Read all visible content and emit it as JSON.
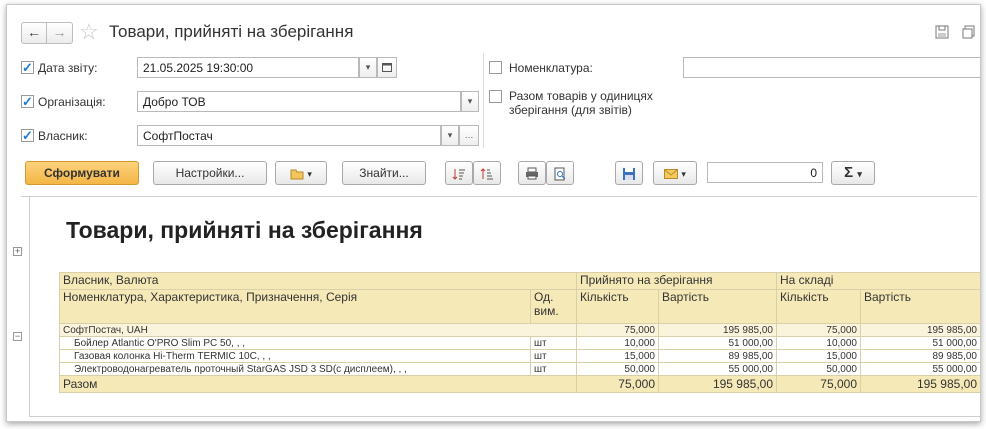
{
  "window": {
    "title": "Товари, прийняті на зберігання",
    "nav_back": "←",
    "nav_forward": "→"
  },
  "filters": {
    "report_date": {
      "label": "Дата звіту:",
      "checked": true,
      "value": "21.05.2025 19:30:00"
    },
    "organization": {
      "label": "Організація:",
      "checked": true,
      "value": "Добро ТОВ"
    },
    "owner": {
      "label": "Власник:",
      "checked": true,
      "value": "СофтПостач"
    },
    "nomenclature": {
      "label": "Номенклатура:",
      "checked": false,
      "value": ""
    },
    "storage_units": {
      "label_line1": "Разом товарів у одиницях",
      "label_line2": "зберігання (для звітів)",
      "checked": false
    }
  },
  "toolbar": {
    "generate": "Сформувати",
    "settings": "Настройки...",
    "find": "Знайти...",
    "sum_value": "0",
    "sum_symbol": "Σ"
  },
  "report": {
    "title": "Товари, прийняті на зберігання",
    "headers": {
      "owner_currency": "Власник, Валюта",
      "nomenclature": "Номенклатура, Характеристика, Призначення, Серія",
      "unit_line1": "Од.",
      "unit_line2": "вим.",
      "accepted": "Прийнято на зберігання",
      "in_stock": "На складі",
      "qty": "Кількість",
      "cost": "Вартість"
    },
    "group": {
      "name": "СофтПостач, UAH",
      "acc_qty": "75,000",
      "acc_cost": "195 985,00",
      "stock_qty": "75,000",
      "stock_cost": "195 985,00"
    },
    "rows": [
      {
        "name": "Бойлер Atlantic O'PRO Slim PC 50, , ,",
        "unit": "шт",
        "acc_qty": "10,000",
        "acc_cost": "51 000,00",
        "stock_qty": "10,000",
        "stock_cost": "51 000,00"
      },
      {
        "name": "Газовая колонка Hi-Therm TERMIC 10C, , ,",
        "unit": "шт",
        "acc_qty": "15,000",
        "acc_cost": "89 985,00",
        "stock_qty": "15,000",
        "stock_cost": "89 985,00"
      },
      {
        "name": "Электроводонагреватель проточный StarGAS JSD 3 SD(с дисплеем), , ,",
        "unit": "шт",
        "acc_qty": "50,000",
        "acc_cost": "55 000,00",
        "stock_qty": "50,000",
        "stock_cost": "55 000,00"
      }
    ],
    "total": {
      "label": "Разом",
      "acc_qty": "75,000",
      "acc_cost": "195 985,00",
      "stock_qty": "75,000",
      "stock_cost": "195 985,00"
    }
  }
}
